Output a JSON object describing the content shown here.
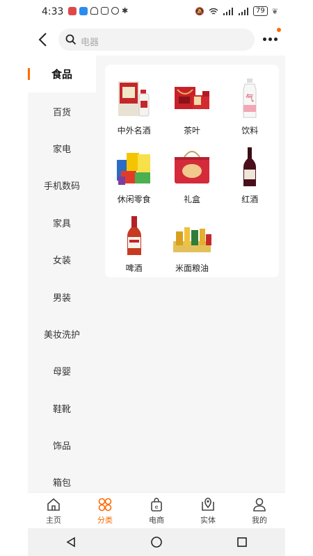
{
  "status": {
    "time": "4:33",
    "battery": "79"
  },
  "search": {
    "placeholder": "电器"
  },
  "sidebar": {
    "items": [
      {
        "label": "食品",
        "active": true
      },
      {
        "label": "百货"
      },
      {
        "label": "家电"
      },
      {
        "label": "手机数码"
      },
      {
        "label": "家具"
      },
      {
        "label": "女装"
      },
      {
        "label": "男装"
      },
      {
        "label": "美妆洗护"
      },
      {
        "label": "母婴"
      },
      {
        "label": "鞋靴"
      },
      {
        "label": "饰品"
      },
      {
        "label": "箱包"
      }
    ]
  },
  "categories": [
    {
      "label": "中外名酒",
      "icon": "baijiu-bottle-icon"
    },
    {
      "label": "茶叶",
      "icon": "tea-gift-box-icon"
    },
    {
      "label": "饮料",
      "icon": "beverage-bottle-icon"
    },
    {
      "label": "休闲零食",
      "icon": "snacks-pile-icon"
    },
    {
      "label": "礼盒",
      "icon": "gift-box-icon"
    },
    {
      "label": "红酒",
      "icon": "red-wine-icon"
    },
    {
      "label": "啤酒",
      "icon": "beer-bottle-icon"
    },
    {
      "label": "米面粮油",
      "icon": "grain-oil-icon"
    }
  ],
  "tabbar": {
    "items": [
      {
        "label": "主页",
        "icon": "home-icon"
      },
      {
        "label": "分类",
        "icon": "category-icon",
        "active": true
      },
      {
        "label": "电商",
        "icon": "shopping-bag-icon"
      },
      {
        "label": "实体",
        "icon": "map-pin-icon"
      },
      {
        "label": "我的",
        "icon": "user-icon"
      }
    ]
  },
  "colors": {
    "accent": "#ff6a00",
    "background": "#f6f6f6"
  }
}
